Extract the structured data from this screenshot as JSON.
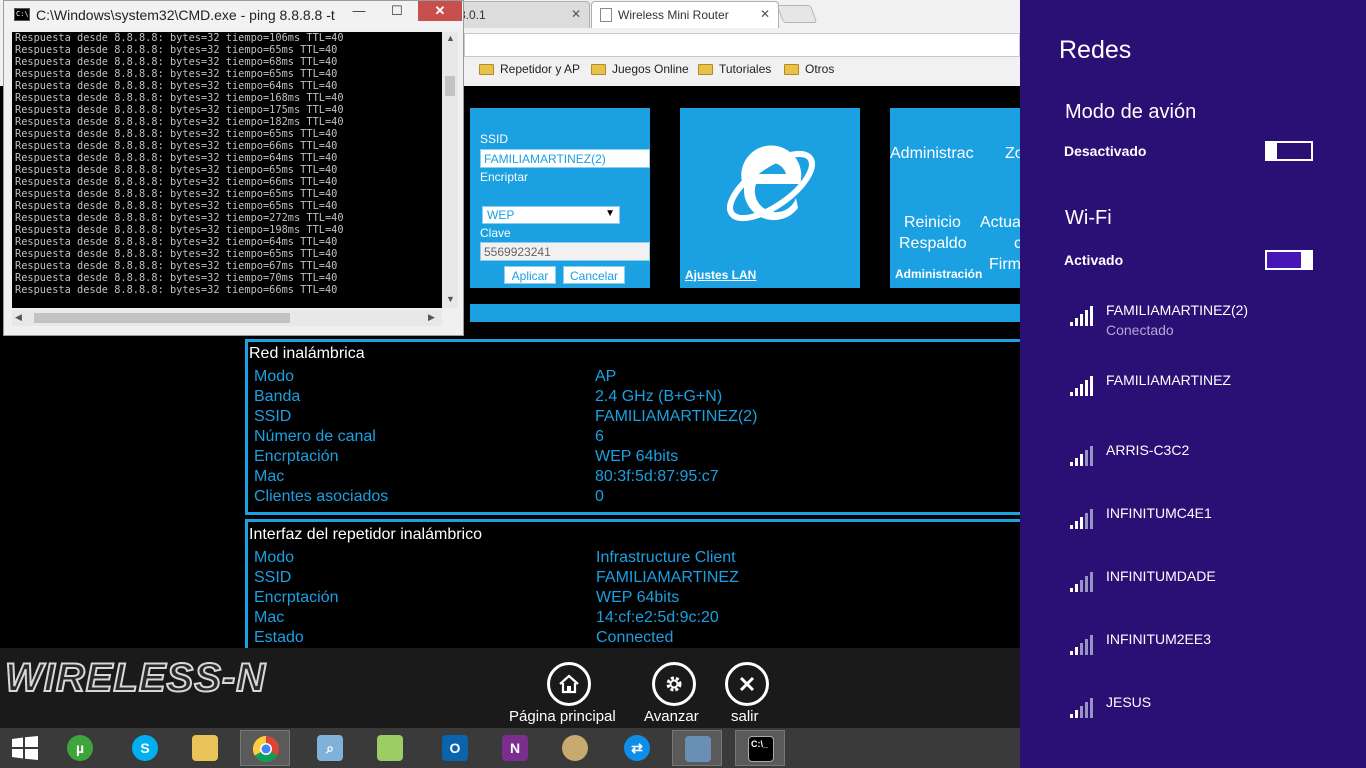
{
  "cmd": {
    "title": "C:\\Windows\\system32\\CMD.exe - ping  8.8.8.8 -t",
    "lines": [
      "Respuesta desde 8.8.8.8: bytes=32 tiempo=106ms TTL=40",
      "Respuesta desde 8.8.8.8: bytes=32 tiempo=65ms TTL=40",
      "Respuesta desde 8.8.8.8: bytes=32 tiempo=68ms TTL=40",
      "Respuesta desde 8.8.8.8: bytes=32 tiempo=65ms TTL=40",
      "Respuesta desde 8.8.8.8: bytes=32 tiempo=64ms TTL=40",
      "Respuesta desde 8.8.8.8: bytes=32 tiempo=168ms TTL=40",
      "Respuesta desde 8.8.8.8: bytes=32 tiempo=175ms TTL=40",
      "Respuesta desde 8.8.8.8: bytes=32 tiempo=182ms TTL=40",
      "Respuesta desde 8.8.8.8: bytes=32 tiempo=65ms TTL=40",
      "Respuesta desde 8.8.8.8: bytes=32 tiempo=66ms TTL=40",
      "Respuesta desde 8.8.8.8: bytes=32 tiempo=64ms TTL=40",
      "Respuesta desde 8.8.8.8: bytes=32 tiempo=65ms TTL=40",
      "Respuesta desde 8.8.8.8: bytes=32 tiempo=66ms TTL=40",
      "Respuesta desde 8.8.8.8: bytes=32 tiempo=65ms TTL=40",
      "Respuesta desde 8.8.8.8: bytes=32 tiempo=65ms TTL=40",
      "Respuesta desde 8.8.8.8: bytes=32 tiempo=272ms TTL=40",
      "Respuesta desde 8.8.8.8: bytes=32 tiempo=198ms TTL=40",
      "Respuesta desde 8.8.8.8: bytes=32 tiempo=64ms TTL=40",
      "Respuesta desde 8.8.8.8: bytes=32 tiempo=65ms TTL=40",
      "Respuesta desde 8.8.8.8: bytes=32 tiempo=67ms TTL=40",
      "Respuesta desde 8.8.8.8: bytes=32 tiempo=70ms TTL=40",
      "Respuesta desde 8.8.8.8: bytes=32 tiempo=66ms TTL=40"
    ]
  },
  "browser": {
    "tabs": [
      {
        "label": "8.0.1"
      },
      {
        "label": "Wireless Mini Router"
      }
    ],
    "bookmarks": [
      "Repetidor y AP",
      "Juegos Online",
      "Tutoriales",
      "Otros"
    ]
  },
  "router": {
    "wifi_tile": {
      "ssid_label": "SSID",
      "ssid_value": "FAMILIAMARTINEZ(2)",
      "encrypt_label": "Encriptar",
      "encrypt_value": "WEP",
      "key_label": "Clave",
      "key_value": "5569923241",
      "apply": "Aplicar",
      "cancel": "Cancelar"
    },
    "lan_tile": {
      "link": "Ajustes LAN"
    },
    "admin_tile": {
      "title": "Administrac",
      "zone": "Zo",
      "reboot": "Reinicio",
      "update": "Actua",
      "backup": "Respaldo",
      "backup_suffix": "c",
      "firmware": "Firm",
      "footer": "Administración"
    },
    "wireless": {
      "title": "Red inalámbrica",
      "rows": [
        {
          "k": "Modo",
          "v": "AP"
        },
        {
          "k": "Banda",
          "v": "2.4 GHz (B+G+N)"
        },
        {
          "k": "SSID",
          "v": "FAMILIAMARTINEZ(2)"
        },
        {
          "k": "Número de canal",
          "v": "6"
        },
        {
          "k": "Encrptación",
          "v": "WEP 64bits"
        },
        {
          "k": "Mac",
          "v": "80:3f:5d:87:95:c7"
        },
        {
          "k": "Clientes asociados",
          "v": "0"
        }
      ]
    },
    "repeater": {
      "title": "Interfaz del repetidor inalámbrico",
      "rows": [
        {
          "k": "Modo",
          "v": "Infrastructure Client"
        },
        {
          "k": "SSID",
          "v": "FAMILIAMARTINEZ"
        },
        {
          "k": "Encrptación",
          "v": "WEP 64bits"
        },
        {
          "k": "Mac",
          "v": "14:cf:e2:5d:9c:20"
        },
        {
          "k": "Estado",
          "v": "Connected"
        }
      ]
    },
    "footer": {
      "brand": "WIRELESS-N",
      "home": "Página principal",
      "advanced": "Avanzar",
      "exit": "salir"
    }
  },
  "network_panel": {
    "title": "Redes",
    "airplane": {
      "label": "Modo de avión",
      "state": "Desactivado"
    },
    "wifi": {
      "label": "Wi-Fi",
      "state": "Activado"
    },
    "networks": [
      {
        "name": "FAMILIAMARTINEZ(2)",
        "status": "Conectado",
        "signal": 5
      },
      {
        "name": "FAMILIAMARTINEZ",
        "status": "",
        "signal": 5
      },
      {
        "name": "ARRIS-C3C2",
        "status": "",
        "signal": 3
      },
      {
        "name": "INFINITUMC4E1",
        "status": "",
        "signal": 3
      },
      {
        "name": "INFINITUMDADE",
        "status": "",
        "signal": 2
      },
      {
        "name": "INFINITUM2EE3",
        "status": "",
        "signal": 2
      },
      {
        "name": "JESUS",
        "status": "",
        "signal": 2
      }
    ]
  },
  "colors": {
    "tile_blue": "#1ba0e2",
    "panel_purple": "#2a0f74",
    "toggle_purple": "#4617b4"
  }
}
